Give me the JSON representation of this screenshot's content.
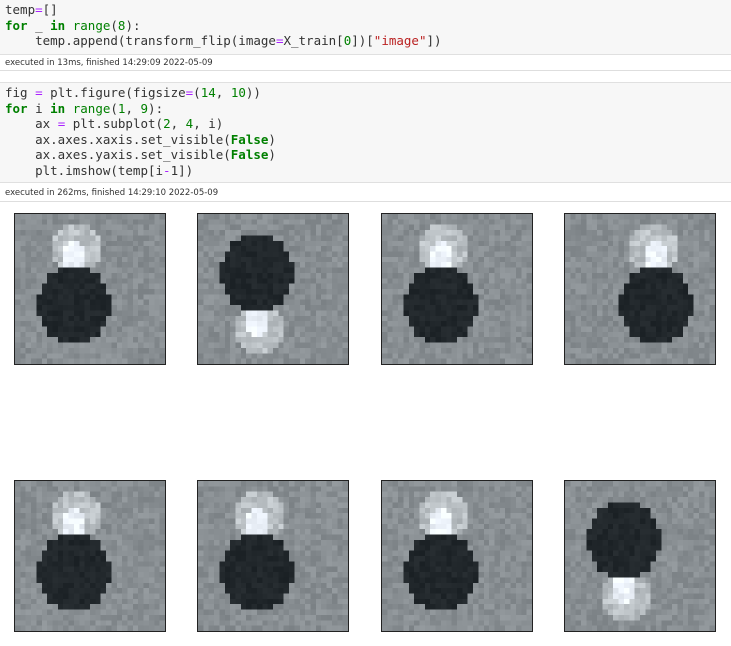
{
  "cell1": {
    "lines": [
      [
        {
          "t": "temp"
        },
        {
          "t": "=",
          "c": "op"
        },
        {
          "t": "[]"
        }
      ],
      [
        {
          "t": "for",
          "c": "kw"
        },
        {
          "t": " _ "
        },
        {
          "t": "in",
          "c": "kw"
        },
        {
          "t": " "
        },
        {
          "t": "range",
          "c": "builtin"
        },
        {
          "t": "("
        },
        {
          "t": "8",
          "c": "num"
        },
        {
          "t": "):"
        }
      ],
      [
        {
          "t": "    temp.append(transform_flip(image"
        },
        {
          "t": "=",
          "c": "op"
        },
        {
          "t": "X_train["
        },
        {
          "t": "0",
          "c": "num"
        },
        {
          "t": "])["
        },
        {
          "t": "\"image\"",
          "c": "str"
        },
        {
          "t": "])"
        }
      ]
    ],
    "exec": "executed in 13ms, finished 14:29:09 2022-05-09"
  },
  "cell2": {
    "lines": [
      [
        {
          "t": "fig "
        },
        {
          "t": "=",
          "c": "op"
        },
        {
          "t": " plt.figure(figsize"
        },
        {
          "t": "=",
          "c": "op"
        },
        {
          "t": "("
        },
        {
          "t": "14",
          "c": "num"
        },
        {
          "t": ", "
        },
        {
          "t": "10",
          "c": "num"
        },
        {
          "t": "))"
        }
      ],
      [
        {
          "t": "for",
          "c": "kw"
        },
        {
          "t": " i "
        },
        {
          "t": "in",
          "c": "kw"
        },
        {
          "t": " "
        },
        {
          "t": "range",
          "c": "builtin"
        },
        {
          "t": "("
        },
        {
          "t": "1",
          "c": "num"
        },
        {
          "t": ", "
        },
        {
          "t": "9",
          "c": "num"
        },
        {
          "t": "):"
        }
      ],
      [
        {
          "t": "    ax "
        },
        {
          "t": "=",
          "c": "op"
        },
        {
          "t": " plt.subplot("
        },
        {
          "t": "2",
          "c": "num"
        },
        {
          "t": ", "
        },
        {
          "t": "4",
          "c": "num"
        },
        {
          "t": ", i)"
        }
      ],
      [
        {
          "t": "    ax.axes.xaxis.set_visible("
        },
        {
          "t": "False",
          "c": "true"
        },
        {
          "t": ")"
        }
      ],
      [
        {
          "t": "    ax.axes.yaxis.set_visible("
        },
        {
          "t": "False",
          "c": "true"
        },
        {
          "t": ")"
        }
      ],
      [
        {
          "t": "    plt.imshow(temp[i"
        },
        {
          "t": "-",
          "c": "op"
        },
        {
          "t": "1"
        },
        {
          "t": "])"
        }
      ]
    ],
    "exec": "executed in 262ms, finished 14:29:10 2022-05-09"
  },
  "output": {
    "subplots": [
      {
        "orientation": "normal"
      },
      {
        "orientation": "vflip"
      },
      {
        "orientation": "normal"
      },
      {
        "orientation": "hflip"
      },
      {
        "orientation": "normal"
      },
      {
        "orientation": "normal"
      },
      {
        "orientation": "normal"
      },
      {
        "orientation": "vflip"
      }
    ]
  }
}
